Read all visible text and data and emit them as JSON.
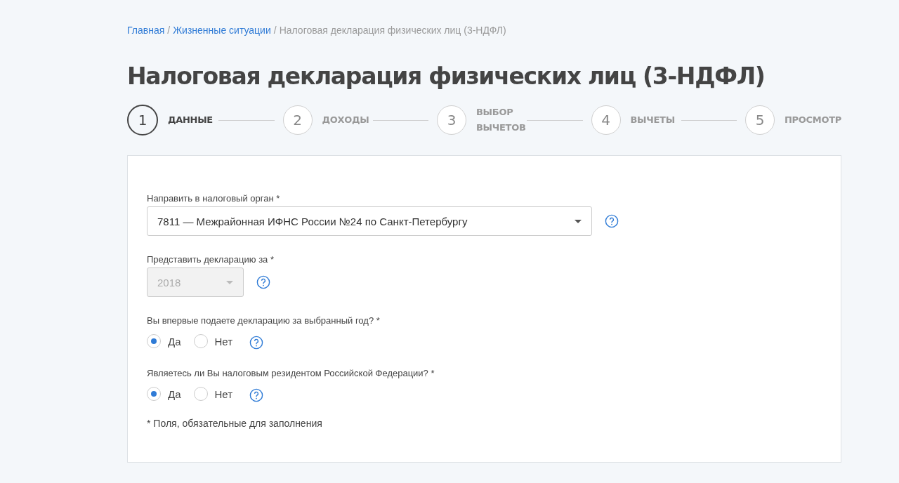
{
  "breadcrumbs": [
    {
      "label": "Главная",
      "link": true,
      "separator": "/"
    },
    {
      "label": "Жизненные ситуации",
      "link": true,
      "separator": "/"
    },
    {
      "label": "Налоговая декларация физических лиц (3-НДФЛ)",
      "link": false
    }
  ],
  "title": "Налоговая декларация физических лиц (3-НДФЛ)",
  "steps": [
    {
      "number": "1",
      "label": "ДАННЫЕ",
      "selected": true
    },
    {
      "number": "2",
      "label": "ДОХОДЫ",
      "selected": false
    },
    {
      "number": "3",
      "label": "ВЫБОР ВЫЧЕТОВ",
      "selected": false
    },
    {
      "number": "4",
      "label": "ВЫЧЕТЫ",
      "selected": false
    },
    {
      "number": "5",
      "label": "ПРОСМОТР",
      "selected": false
    }
  ],
  "fields": [
    {
      "kind": "select",
      "label": "Направить в налоговый орган *",
      "value": "7811 — Межрайонная ИФНС России №24 по Санкт-Петербургу",
      "disabled": false,
      "wide": true
    },
    {
      "kind": "select",
      "label": "Представить декларацию за *",
      "value": "2018",
      "disabled": true,
      "wide": false
    },
    {
      "kind": "radio",
      "label": "Вы впервые подаете декларацию за выбранный год? *",
      "options": [
        {
          "label": "Да",
          "selected": true
        },
        {
          "label": "Нет",
          "selected": false
        }
      ]
    },
    {
      "kind": "radio",
      "label": "Являетесь ли Вы налоговым резидентом Российской Федерации? *",
      "options": [
        {
          "label": "Да",
          "selected": true
        },
        {
          "label": "Нет",
          "selected": false
        }
      ]
    }
  ],
  "footnote": "* Поля, обязательные для заполнения"
}
